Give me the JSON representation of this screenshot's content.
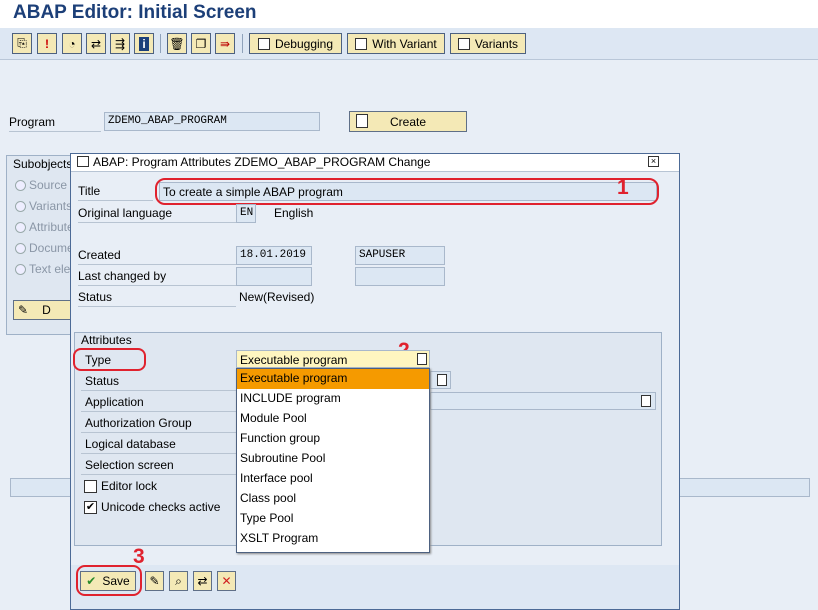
{
  "window": {
    "title": "ABAP Editor: Initial Screen"
  },
  "toolbar": {
    "icons": [
      "object-list-icon",
      "info-icon",
      "activate-icon",
      "where-used-icon",
      "navigate-icon",
      "info-system-icon",
      "delete-icon",
      "copy-icon",
      "rename-icon"
    ],
    "debugging_label": "Debugging",
    "with_variant_label": "With Variant",
    "variants_label": "Variants"
  },
  "main": {
    "program_label": "Program",
    "program_value": "ZDEMO_ABAP_PROGRAM",
    "create_label": "Create",
    "subobjects_label": "Subobjects",
    "subobjects": [
      "Source",
      "Variants",
      "Attributes",
      "Documentation",
      "Text elements"
    ],
    "display_partial": "D"
  },
  "dialog": {
    "title": "ABAP: Program Attributes ZDEMO_ABAP_PROGRAM Change",
    "title_label": "Title",
    "title_value": "To create a simple ABAP program",
    "orig_lang_label": "Original language",
    "orig_lang_code": "EN",
    "orig_lang_name": "English",
    "created_label": "Created",
    "created_date": "18.01.2019",
    "created_user": "SAPUSER",
    "last_changed_label": "Last changed by",
    "status_label": "Status",
    "status_value": "New(Revised)",
    "attributes_group": "Attributes",
    "type_label": "Type",
    "type_value": "Executable program",
    "status2_label": "Status",
    "application_label": "Application",
    "auth_group_label": "Authorization Group",
    "logical_db_label": "Logical database",
    "selection_screen_label": "Selection screen",
    "editor_lock_label": "Editor lock",
    "unicode_label": "Unicode checks active",
    "save_label": "Save",
    "type_options": [
      "Executable program",
      "INCLUDE program",
      "Module Pool",
      "Function group",
      "Subroutine Pool",
      "Interface pool",
      "Class pool",
      "Type Pool",
      "XSLT Program"
    ]
  },
  "annotations": {
    "n1": "1",
    "n2": "2",
    "n3": "3"
  },
  "colors": {
    "accent_red": "#e0222e",
    "title_blue": "#1c3f78",
    "highlight": "#f59a00"
  }
}
